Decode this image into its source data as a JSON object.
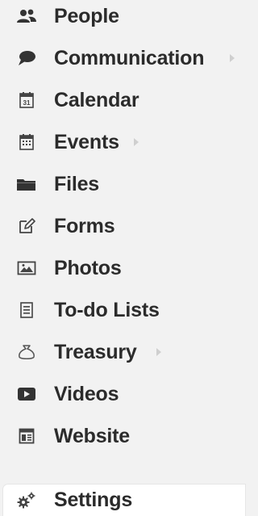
{
  "menu": {
    "items": [
      {
        "label": "People",
        "icon": "people-icon"
      },
      {
        "label": "Communication",
        "icon": "chat-bubble-icon",
        "has_submenu": true
      },
      {
        "label": "Calendar",
        "icon": "calendar-icon"
      },
      {
        "label": "Events",
        "icon": "event-calendar-icon",
        "has_submenu": true
      },
      {
        "label": "Files",
        "icon": "folder-icon"
      },
      {
        "label": "Forms",
        "icon": "edit-form-icon"
      },
      {
        "label": "Photos",
        "icon": "photo-icon"
      },
      {
        "label": "To-do Lists",
        "icon": "checklist-icon"
      },
      {
        "label": "Treasury",
        "icon": "treasury-icon",
        "has_submenu": true
      },
      {
        "label": "Videos",
        "icon": "video-play-icon"
      },
      {
        "label": "Website",
        "icon": "website-icon"
      }
    ]
  },
  "settings": {
    "label": "Settings",
    "icon": "gears-icon"
  },
  "colors": {
    "background": "#f2f2f2",
    "text": "#2b2b2b",
    "icon": "#333333",
    "submenu_arrow": "#cfcfcf",
    "settings_background": "#ffffff"
  }
}
